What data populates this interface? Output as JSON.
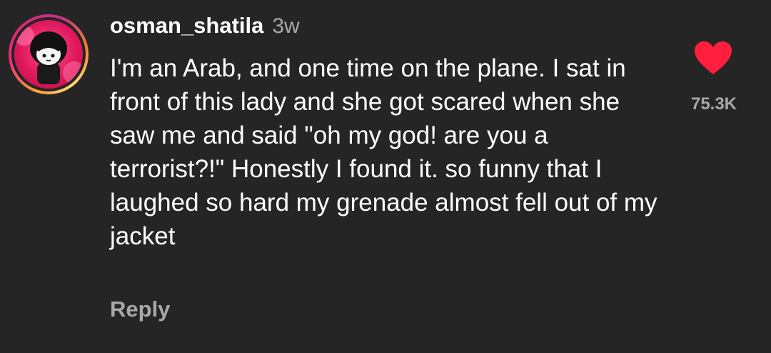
{
  "comment": {
    "username": "osman_shatila",
    "time_ago": "3w",
    "text": "I'm an Arab, and one time on the plane. I sat in front of this lady and she got scared when she saw me and said \"oh my god! are you a terrorist?!\" Honestly I found it. so funny that I laughed so hard my grenade almost fell out of my jacket",
    "reply_label": "Reply",
    "like_count": "75.3K",
    "liked": true,
    "avatar_icon": "avatar-character-icon",
    "like_icon": "heart-icon"
  },
  "colors": {
    "background": "#252525",
    "text_primary": "#ffffff",
    "text_secondary": "#a8a8a8",
    "heart": "#ff1f3d",
    "avatar_bg": "#e0185e"
  }
}
